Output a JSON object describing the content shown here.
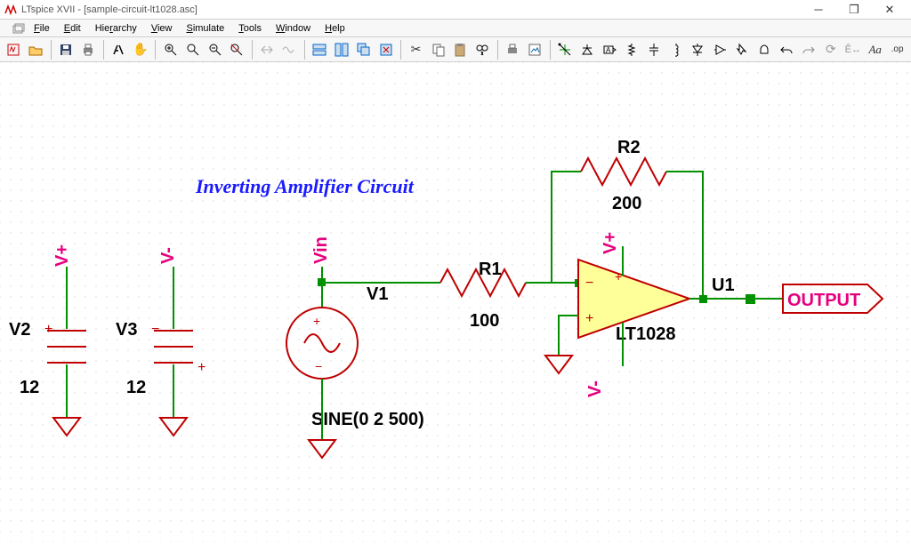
{
  "app": {
    "title": "LTspice XVII - [sample-circuit-lt1028.asc]"
  },
  "menu": {
    "file": "File",
    "edit": "Edit",
    "hierarchy": "Hierarchy",
    "view": "View",
    "simulate": "Simulate",
    "tools": "Tools",
    "window": "Window",
    "help": "Help"
  },
  "schematic": {
    "title": "Inverting Amplifier Circuit",
    "v2": {
      "ref": "V2",
      "value": "12"
    },
    "v3": {
      "ref": "V3",
      "value": "12"
    },
    "v1": {
      "ref": "V1",
      "sine": "SINE(0 2 500)"
    },
    "r1": {
      "ref": "R1",
      "value": "100"
    },
    "r2": {
      "ref": "R2",
      "value": "200"
    },
    "u1": {
      "ref": "U1",
      "model": "LT1028"
    },
    "nets": {
      "vplus": "V+",
      "vminus": "V-",
      "vin": "Vin",
      "opvp": "V+",
      "opvm": "V-"
    },
    "output": "OUTPUT"
  }
}
